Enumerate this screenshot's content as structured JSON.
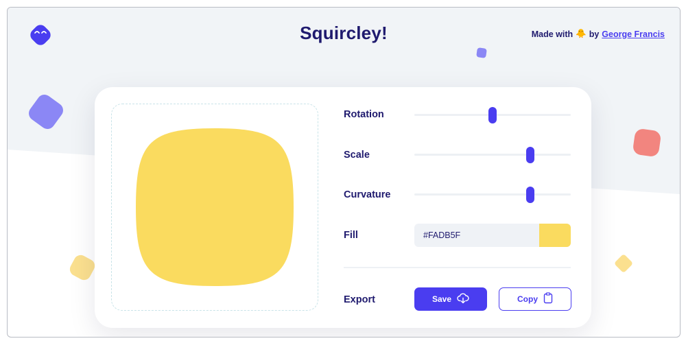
{
  "header": {
    "title": "Squircley!",
    "credits_prefix": "Made with",
    "credits_emoji": "🐥",
    "credits_by": "by",
    "author": "George Francis"
  },
  "controls": {
    "rotation": {
      "label": "Rotation",
      "value": 0.5
    },
    "scale": {
      "label": "Scale",
      "value": 0.74
    },
    "curvature": {
      "label": "Curvature",
      "value": 0.74
    },
    "fill": {
      "label": "Fill",
      "value": "#FADB5F"
    },
    "export": {
      "label": "Export",
      "save_label": "Save",
      "copy_label": "Copy"
    }
  },
  "colors": {
    "accent": "#4a3df0",
    "title": "#1f1a6e",
    "shape_fill": "#FADB5F",
    "deco_purple": "#8b87f5",
    "deco_red": "#f2857f",
    "deco_yellow": "#fbe08f"
  },
  "icons": {
    "logo": "smiling-squircle-icon",
    "save": "cloud-download-icon",
    "copy": "clipboard-icon"
  }
}
